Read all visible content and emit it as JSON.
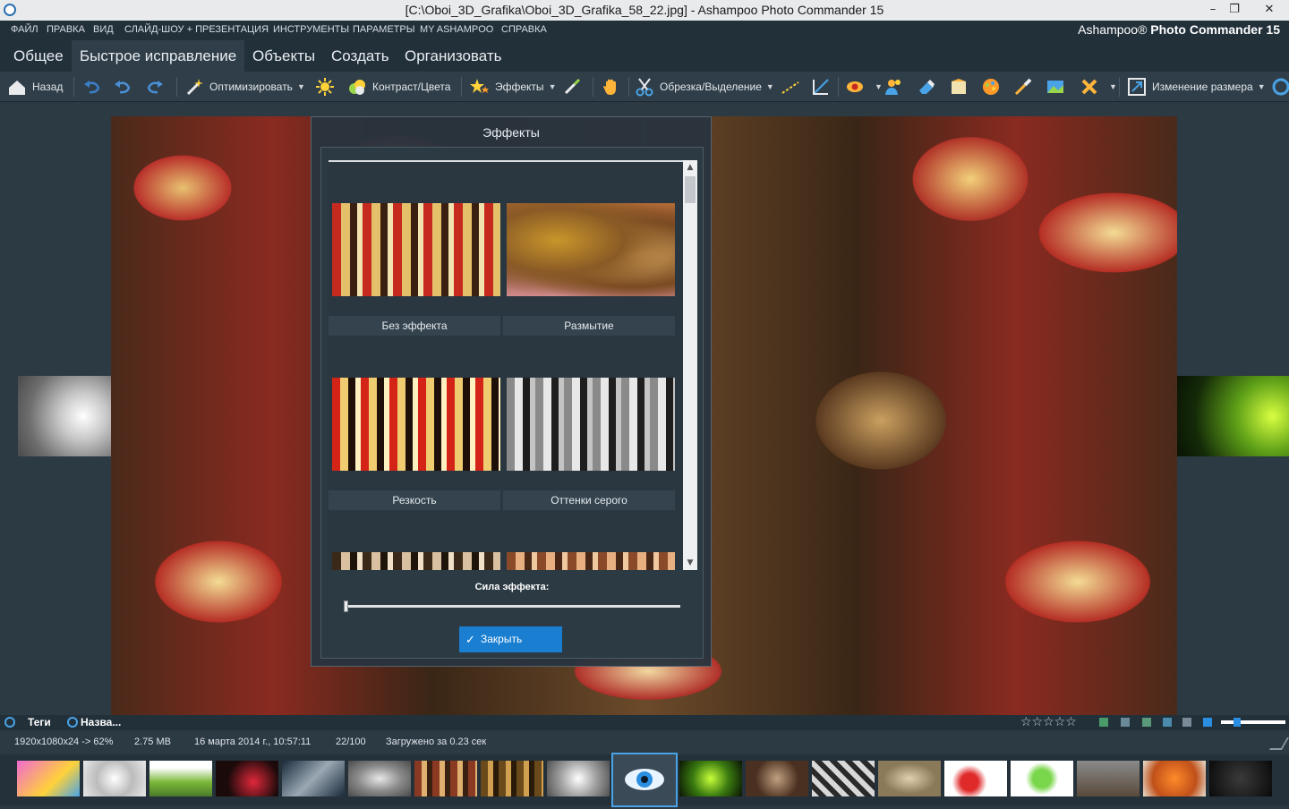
{
  "window": {
    "title": "[C:\\Oboi_3D_Grafika\\Oboi_3D_Grafika_58_22.jpg] - Ashampoo Photo Commander 15",
    "minimize": "–",
    "restore": "❐",
    "close": "✕"
  },
  "menu": {
    "items": [
      "ФАЙЛ",
      "ПРАВКА",
      "ВИД",
      "СЛАЙД-ШОУ + ПРЕЗЕНТАЦИЯ",
      "ИНСТРУМЕНТЫ",
      "ПАРАМЕТРЫ",
      "MY ASHAMPOO",
      "СПРАВКА"
    ],
    "brand_prefix": "Ashampoo®",
    "brand_name": "Photo Commander 15"
  },
  "tabs": [
    "Общее",
    "Быстрое исправление",
    "Объекты",
    "Создать",
    "Организовать"
  ],
  "active_tab": "Быстрое исправление",
  "toolbar": {
    "back": "Назад",
    "optimize": "Оптимизировать",
    "contrast": "Контраст/Цвета",
    "effects": "Эффекты",
    "crop": "Обрезка/Выделение",
    "resize": "Изменение размера"
  },
  "dialog": {
    "title": "Эффекты",
    "effects": [
      {
        "label": "Без эффекта"
      },
      {
        "label": "Размытие"
      },
      {
        "label": "Резкость"
      },
      {
        "label": "Оттенки серого"
      }
    ],
    "strength_label": "Сила эффекта:",
    "strength_value": 0,
    "close_label": "Закрыть"
  },
  "tagbar": {
    "tags": "Теги",
    "name": "Назва..."
  },
  "rating": "☆☆☆☆☆",
  "status": {
    "resolution": "1920x1080x24 -> 62%",
    "size": "2.75 MB",
    "date": "16 марта 2014 г., 10:57:11",
    "position": "22/100",
    "loaded": "Загружено за 0.23 сек"
  },
  "colors": {
    "accent": "#1a7fd0",
    "background": "#2b3741",
    "toolbar": "#2f3e49"
  }
}
